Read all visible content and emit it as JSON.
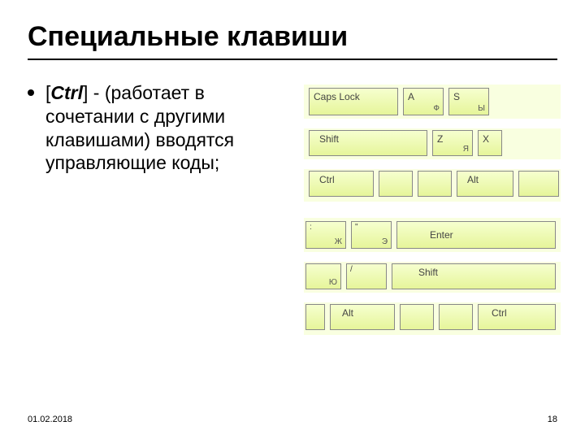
{
  "title": "Специальные клавиши",
  "bullet": {
    "prefix": "[",
    "key": "Ctrl",
    "suffix": "]  - (работает в сочетании с другими клавишами) вводятся управляющие коды;"
  },
  "footer": {
    "date": "01.02.2018",
    "page": "18"
  },
  "kb1": {
    "r1": {
      "caps": "Caps Lock",
      "a": {
        "main": "A",
        "sub": "Ф"
      },
      "s": {
        "main": "S",
        "sub": "Ы"
      }
    },
    "r2": {
      "shift": "Shift",
      "z": {
        "main": "Z",
        "sub": "Я"
      },
      "x": {
        "main": "X"
      }
    },
    "r3": {
      "ctrl": "Ctrl",
      "alt": "Alt"
    }
  },
  "kb2": {
    "r1": {
      "k1": {
        "tl": ":",
        "sub": "Ж"
      },
      "k2": {
        "tl": "\"",
        "sub": "Э"
      },
      "enter": "Enter"
    },
    "r2": {
      "k1": {
        "sub": "Ю"
      },
      "k2": {
        "tl": "/"
      },
      "shift": "Shift"
    },
    "r3": {
      "alt": "Alt",
      "ctrl": "Ctrl"
    }
  }
}
